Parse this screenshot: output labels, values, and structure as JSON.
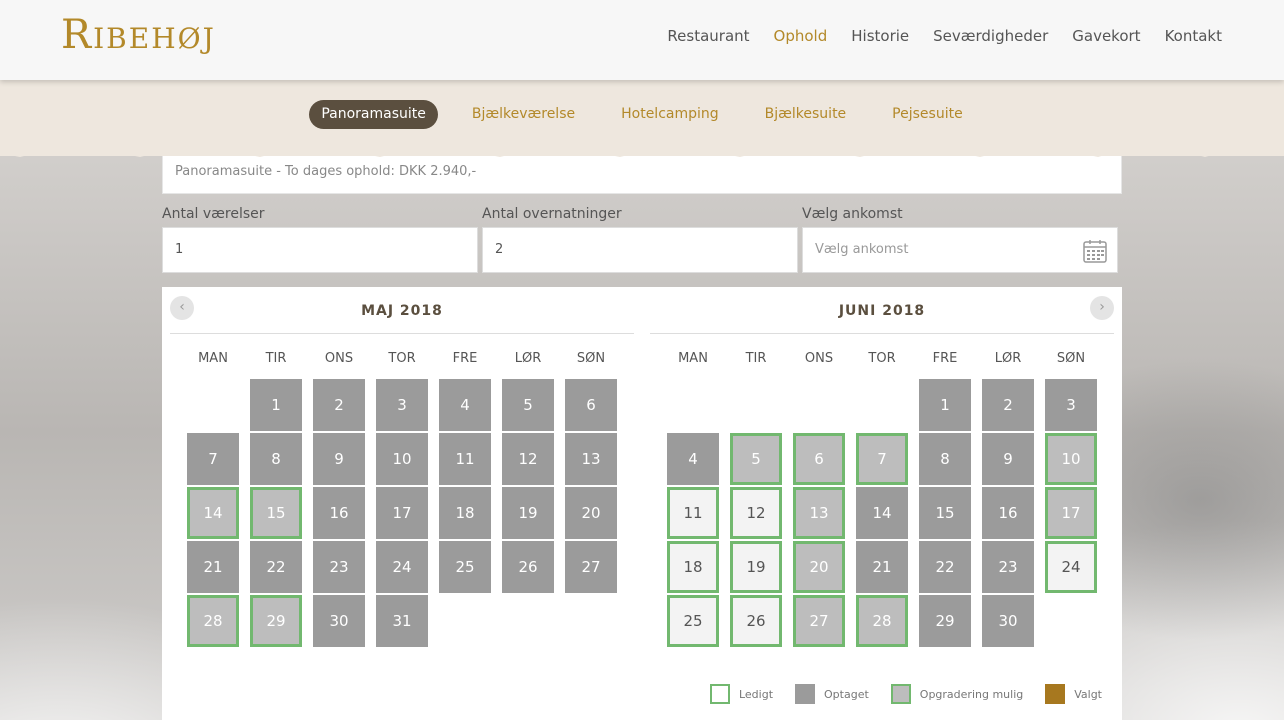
{
  "brand": {
    "name": "Ribehøj",
    "accent": "#b3892a"
  },
  "nav": {
    "items": [
      {
        "label": "Restaurant",
        "active": false
      },
      {
        "label": "Ophold",
        "active": true
      },
      {
        "label": "Historie",
        "active": false
      },
      {
        "label": "Seværdigheder",
        "active": false
      },
      {
        "label": "Gavekort",
        "active": false
      },
      {
        "label": "Kontakt",
        "active": false
      }
    ]
  },
  "subnav": {
    "items": [
      {
        "label": "Panoramasuite",
        "active": true
      },
      {
        "label": "Bjælkeværelse",
        "active": false
      },
      {
        "label": "Hotelcamping",
        "active": false
      },
      {
        "label": "Bjælkesuite",
        "active": false
      },
      {
        "label": "Pejsesuite",
        "active": false
      }
    ]
  },
  "booking": {
    "price_text": "Panoramasuite - To dages ophold: DKK 2.940,-",
    "rooms": {
      "label": "Antal værelser",
      "value": "1"
    },
    "nights": {
      "label": "Antal overnatninger",
      "value": "2"
    },
    "arrival": {
      "label": "Vælg ankomst",
      "placeholder": "Vælg ankomst",
      "icon": "calendar-icon"
    }
  },
  "calendar": {
    "weekdays": [
      "MAN",
      "TIR",
      "ONS",
      "TOR",
      "FRE",
      "LØR",
      "SØN"
    ],
    "prev_icon": "chevron-left-icon",
    "next_icon": "chevron-right-icon",
    "months": [
      {
        "title": "MAJ 2018",
        "first_weekday": 1,
        "days": [
          {
            "d": "1",
            "s": "busy"
          },
          {
            "d": "2",
            "s": "busy"
          },
          {
            "d": "3",
            "s": "busy"
          },
          {
            "d": "4",
            "s": "busy"
          },
          {
            "d": "5",
            "s": "busy"
          },
          {
            "d": "6",
            "s": "busy"
          },
          {
            "d": "7",
            "s": "busy"
          },
          {
            "d": "8",
            "s": "busy"
          },
          {
            "d": "9",
            "s": "busy"
          },
          {
            "d": "10",
            "s": "busy"
          },
          {
            "d": "11",
            "s": "busy"
          },
          {
            "d": "12",
            "s": "busy"
          },
          {
            "d": "13",
            "s": "busy"
          },
          {
            "d": "14",
            "s": "up"
          },
          {
            "d": "15",
            "s": "up"
          },
          {
            "d": "16",
            "s": "busy"
          },
          {
            "d": "17",
            "s": "busy"
          },
          {
            "d": "18",
            "s": "busy"
          },
          {
            "d": "19",
            "s": "busy"
          },
          {
            "d": "20",
            "s": "busy"
          },
          {
            "d": "21",
            "s": "busy"
          },
          {
            "d": "22",
            "s": "busy"
          },
          {
            "d": "23",
            "s": "busy"
          },
          {
            "d": "24",
            "s": "busy"
          },
          {
            "d": "25",
            "s": "busy"
          },
          {
            "d": "26",
            "s": "busy"
          },
          {
            "d": "27",
            "s": "busy"
          },
          {
            "d": "28",
            "s": "up"
          },
          {
            "d": "29",
            "s": "up"
          },
          {
            "d": "30",
            "s": "busy"
          },
          {
            "d": "31",
            "s": "busy"
          }
        ]
      },
      {
        "title": "JUNI 2018",
        "first_weekday": 4,
        "days": [
          {
            "d": "1",
            "s": "busy"
          },
          {
            "d": "2",
            "s": "busy"
          },
          {
            "d": "3",
            "s": "busy"
          },
          {
            "d": "4",
            "s": "busy"
          },
          {
            "d": "5",
            "s": "up"
          },
          {
            "d": "6",
            "s": "up"
          },
          {
            "d": "7",
            "s": "up"
          },
          {
            "d": "8",
            "s": "busy"
          },
          {
            "d": "9",
            "s": "busy"
          },
          {
            "d": "10",
            "s": "up"
          },
          {
            "d": "11",
            "s": "free"
          },
          {
            "d": "12",
            "s": "free"
          },
          {
            "d": "13",
            "s": "up"
          },
          {
            "d": "14",
            "s": "busy"
          },
          {
            "d": "15",
            "s": "busy"
          },
          {
            "d": "16",
            "s": "busy"
          },
          {
            "d": "17",
            "s": "up"
          },
          {
            "d": "18",
            "s": "free"
          },
          {
            "d": "19",
            "s": "free"
          },
          {
            "d": "20",
            "s": "up"
          },
          {
            "d": "21",
            "s": "busy"
          },
          {
            "d": "22",
            "s": "busy"
          },
          {
            "d": "23",
            "s": "busy"
          },
          {
            "d": "24",
            "s": "free"
          },
          {
            "d": "25",
            "s": "free"
          },
          {
            "d": "26",
            "s": "free"
          },
          {
            "d": "27",
            "s": "up"
          },
          {
            "d": "28",
            "s": "up"
          },
          {
            "d": "29",
            "s": "busy"
          },
          {
            "d": "30",
            "s": "busy"
          }
        ]
      }
    ]
  },
  "legend": [
    {
      "label": "Ledigt",
      "fill": "#ffffff",
      "border": "#72b86f"
    },
    {
      "label": "Optaget",
      "fill": "#9b9b9b",
      "border": "#9b9b9b"
    },
    {
      "label": "Opgradering mulig",
      "fill": "#bdbdbd",
      "border": "#72b86f"
    },
    {
      "label": "Valgt",
      "fill": "#a7781f",
      "border": "#a7781f"
    }
  ]
}
